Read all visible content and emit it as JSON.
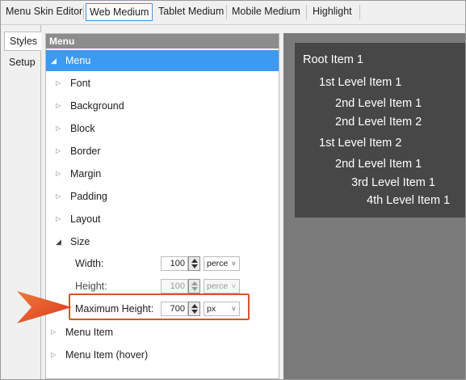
{
  "top_tabs": [
    {
      "label": "Menu Skin Editor",
      "active": false
    },
    {
      "label": "Web Medium",
      "active": true
    },
    {
      "label": "Tablet Medium",
      "active": false
    },
    {
      "label": "Mobile Medium",
      "active": false
    },
    {
      "label": "Highlight",
      "active": false
    }
  ],
  "side_tabs": [
    {
      "label": "Styles",
      "active": true
    },
    {
      "label": "Setup",
      "active": false
    }
  ],
  "panel": {
    "header": "Menu",
    "root": {
      "label": "Menu",
      "selected": true,
      "expanded": true
    },
    "sections": [
      {
        "label": "Font",
        "expanded": false
      },
      {
        "label": "Background",
        "expanded": false
      },
      {
        "label": "Block",
        "expanded": false
      },
      {
        "label": "Border",
        "expanded": false
      },
      {
        "label": "Margin",
        "expanded": false
      },
      {
        "label": "Padding",
        "expanded": false
      },
      {
        "label": "Layout",
        "expanded": false
      },
      {
        "label": "Size",
        "expanded": true
      }
    ],
    "size_props": [
      {
        "label": "Width:",
        "value": "100",
        "unit": "perce",
        "enabled": true
      },
      {
        "label": "Height:",
        "value": "100",
        "unit": "perce",
        "enabled": false
      },
      {
        "label": "Maximum Height:",
        "value": "700",
        "unit": "px",
        "enabled": true,
        "highlighted": true
      }
    ],
    "siblings": [
      {
        "label": "Menu Item",
        "expanded": false
      },
      {
        "label": "Menu Item (hover)",
        "expanded": false
      }
    ]
  },
  "preview": {
    "items": [
      {
        "label": "Root Item 1",
        "level": 0
      },
      {
        "label": "1st Level Item 1",
        "level": 1
      },
      {
        "label": "2nd Level Item 1",
        "level": 2
      },
      {
        "label": "2nd Level Item 2",
        "level": 2
      },
      {
        "label": "1st Level Item 2",
        "level": 1
      },
      {
        "label": "2nd Level Item 1",
        "level": 2
      },
      {
        "label": "3rd Level Item 1",
        "level": 3
      },
      {
        "label": "4th Level Item 1",
        "level": 4
      }
    ]
  },
  "icons": {
    "expand": "chevron-right-icon",
    "collapse": "caret-down-icon",
    "dropdown": "chevron-down-icon",
    "callout": "arrow-pointer-icon"
  },
  "colors": {
    "selection": "#3d9af2",
    "panel_header": "#8c8c8c",
    "callout": "#e8502a",
    "highlight_border": "#d9532c",
    "preview_bg": "#7a7a7a",
    "menu_bg": "#474747"
  }
}
